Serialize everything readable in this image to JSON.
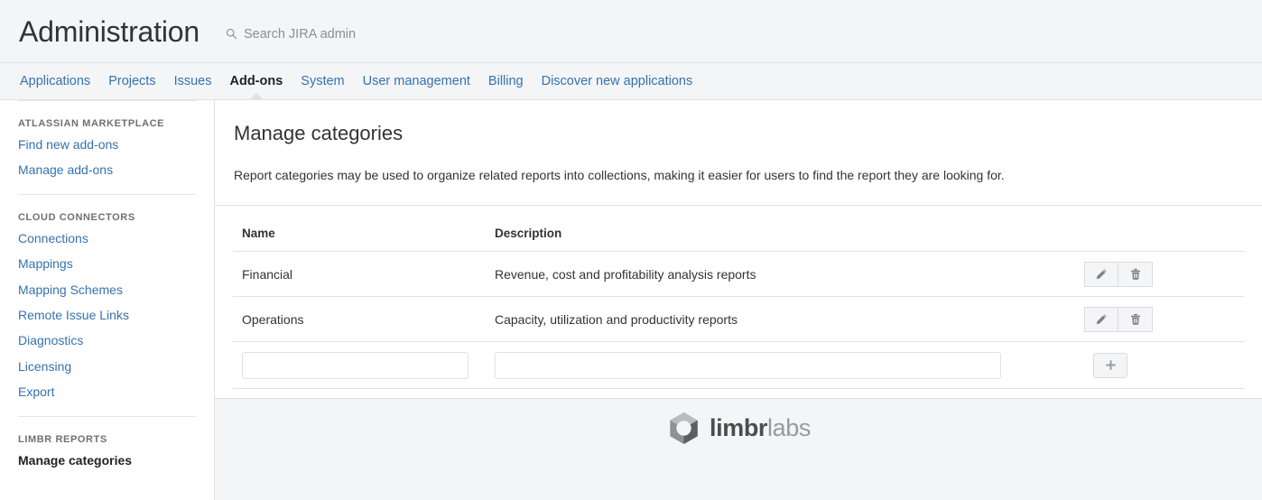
{
  "header": {
    "title": "Administration",
    "search_placeholder": "Search JIRA admin",
    "search_icon": "search-icon"
  },
  "nav": {
    "items": [
      {
        "label": "Applications",
        "active": false
      },
      {
        "label": "Projects",
        "active": false
      },
      {
        "label": "Issues",
        "active": false
      },
      {
        "label": "Add-ons",
        "active": true
      },
      {
        "label": "System",
        "active": false
      },
      {
        "label": "User management",
        "active": false
      },
      {
        "label": "Billing",
        "active": false
      },
      {
        "label": "Discover new applications",
        "active": false
      }
    ]
  },
  "sidebar": {
    "groups": [
      {
        "heading": "ATLASSIAN MARKETPLACE",
        "items": [
          {
            "label": "Find new add-ons",
            "current": false
          },
          {
            "label": "Manage add-ons",
            "current": false
          }
        ]
      },
      {
        "heading": "CLOUD CONNECTORS",
        "items": [
          {
            "label": "Connections",
            "current": false
          },
          {
            "label": "Mappings",
            "current": false
          },
          {
            "label": "Mapping Schemes",
            "current": false
          },
          {
            "label": "Remote Issue Links",
            "current": false
          },
          {
            "label": "Diagnostics",
            "current": false
          },
          {
            "label": "Licensing",
            "current": false
          },
          {
            "label": "Export",
            "current": false
          }
        ]
      },
      {
        "heading": "LIMBR REPORTS",
        "items": [
          {
            "label": "Manage categories",
            "current": true
          }
        ]
      }
    ]
  },
  "main": {
    "title": "Manage categories",
    "description": "Report categories may be used to organize related reports into collections, making it easier for users to find the report they are looking for.",
    "table": {
      "columns": [
        "Name",
        "Description",
        ""
      ],
      "rows": [
        {
          "name": "Financial",
          "description": "Revenue, cost and profitability analysis reports",
          "edit_icon": "pencil-icon",
          "delete_icon": "trash-icon"
        },
        {
          "name": "Operations",
          "description": "Capacity, utilization and productivity reports",
          "edit_icon": "pencil-icon",
          "delete_icon": "trash-icon"
        }
      ],
      "add_row": {
        "name_value": "",
        "name_placeholder": "",
        "description_value": "",
        "description_placeholder": "",
        "add_icon": "plus-icon"
      }
    }
  },
  "footer": {
    "logo_bold": "limbr",
    "logo_light": "labs",
    "logo_icon": "hex-nut-icon"
  },
  "colors": {
    "link": "#3572b0",
    "header_bg": "#f4f5f7",
    "border": "#dfe1e5",
    "text": "#333333"
  }
}
